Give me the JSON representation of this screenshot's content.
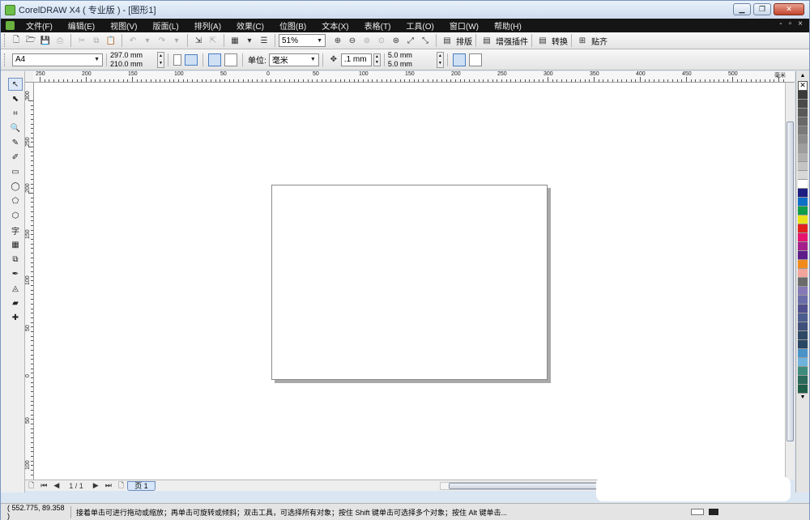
{
  "window": {
    "title": "CorelDRAW X4 ( 专业版 ) - [图形1]",
    "min_glyph": "▁",
    "restore_glyph": "❐",
    "close_glyph": "✕"
  },
  "menu": {
    "items": [
      "文件(F)",
      "编辑(E)",
      "视图(V)",
      "版面(L)",
      "排列(A)",
      "效果(C)",
      "位图(B)",
      "文本(X)",
      "表格(T)",
      "工具(O)",
      "窗口(W)",
      "帮助(H)"
    ],
    "doc_controls": [
      "-",
      "▫",
      "×"
    ]
  },
  "standard_toolbar": {
    "zoom_value": "51%",
    "plugins": [
      "排版",
      "增强插件",
      "转换",
      "贴齐"
    ]
  },
  "property_bar": {
    "paper_size": "A4",
    "width": "297.0 mm",
    "height": "210.0 mm",
    "units_label": "单位:",
    "units_value": "毫米",
    "nudge": ".1 mm",
    "dup_x": "5.0 mm",
    "dup_y": "5.0 mm"
  },
  "rulers": {
    "horizontal": [
      "250",
      "200",
      "150",
      "100",
      "50",
      "0",
      "50",
      "100",
      "150",
      "200",
      "250",
      "300",
      "350",
      "400",
      "450",
      "500",
      "毫米"
    ],
    "vertical": [
      "300",
      "250",
      "200",
      "150",
      "100",
      "50",
      "0",
      "50",
      "100"
    ]
  },
  "tools": [
    "pick-icon",
    "shape-icon",
    "crop-icon",
    "zoom-icon",
    "freehand-icon",
    "smart-fill-icon",
    "rectangle-icon",
    "ellipse-icon",
    "polygon-icon",
    "basic-shapes-icon",
    "text-icon",
    "table-icon",
    "blend-icon",
    "eyedropper-icon",
    "outline-icon",
    "fill-icon",
    "interactive-fill-icon"
  ],
  "tool_glyphs": [
    "↖",
    "⬉",
    "⌗",
    "🔍",
    "✎",
    "✐",
    "▭",
    "◯",
    "⬠",
    "⬡",
    "字",
    "▦",
    "⧉",
    "✒",
    "◬",
    "▰",
    "✚"
  ],
  "palette_colors": [
    "#3b3b3b",
    "#4a4a4a",
    "#595959",
    "#696969",
    "#7a7a7a",
    "#8c8c8c",
    "#9e9e9e",
    "#b0b0b0",
    "#c4c4c4",
    "#d8d8d8",
    "#ffffff",
    "#1e1d80",
    "#0d6fc6",
    "#119d49",
    "#e9e21b",
    "#e2211c",
    "#e6156f",
    "#a41f8b",
    "#5d1c8a",
    "#f18a1a",
    "#f2a59a",
    "#6b6b6b",
    "#857ab7",
    "#6a6ea8",
    "#4f4f8f",
    "#4b5d8f",
    "#3e4f7a",
    "#2e4866",
    "#284563",
    "#4a93c9",
    "#6fb3dd",
    "#3d8b7a",
    "#2a6a5a",
    "#1f5f4a"
  ],
  "page_nav": {
    "page_counter": "1 / 1",
    "page_tab": "页 1"
  },
  "status": {
    "coords": "( 552.775, 89.358 )",
    "hint": "接着单击可进行拖动或缩放；再单击可旋转或倾斜；双击工具，可选择所有对象；按住 Shift 键单击可选择多个对象；按住 Alt 键单击..."
  }
}
